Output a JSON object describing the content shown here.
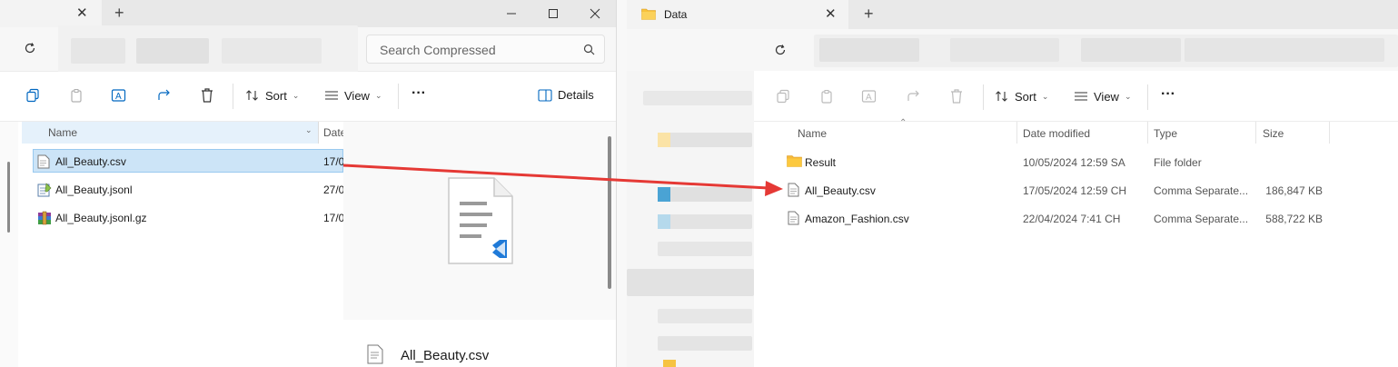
{
  "left_window": {
    "search_placeholder": "Search Compressed",
    "toolbar": {
      "sort": "Sort",
      "view": "View",
      "more": "···",
      "details": "Details"
    },
    "columns": {
      "name": "Name",
      "date": "Date"
    },
    "files": [
      {
        "name": "All_Beauty.csv",
        "date": "17/0",
        "icon": "text-file-icon",
        "selected": true
      },
      {
        "name": "All_Beauty.jsonl",
        "date": "27/0",
        "icon": "notepad-file-icon"
      },
      {
        "name": "All_Beauty.jsonl.gz",
        "date": "17/0",
        "icon": "archive-file-icon"
      }
    ],
    "preview_filename": "All_Beauty.csv"
  },
  "right_window": {
    "tab_title": "Data",
    "toolbar": {
      "sort": "Sort",
      "view": "View",
      "more": "···"
    },
    "columns": {
      "name": "Name",
      "date": "Date modified",
      "type": "Type",
      "size": "Size"
    },
    "files": [
      {
        "name": "Result",
        "date": "10/05/2024 12:59 SA",
        "type": "File folder",
        "size": "",
        "icon": "folder-icon"
      },
      {
        "name": "All_Beauty.csv",
        "date": "17/05/2024 12:59 CH",
        "type": "Comma Separate...",
        "size": "186,847 KB",
        "icon": "text-file-icon"
      },
      {
        "name": "Amazon_Fashion.csv",
        "date": "22/04/2024 7:41 CH",
        "type": "Comma Separate...",
        "size": "588,722 KB",
        "icon": "text-file-icon"
      }
    ]
  },
  "colors": {
    "arrow": "#e53935",
    "selection": "#cce4f7",
    "accent": "#0067c0"
  }
}
